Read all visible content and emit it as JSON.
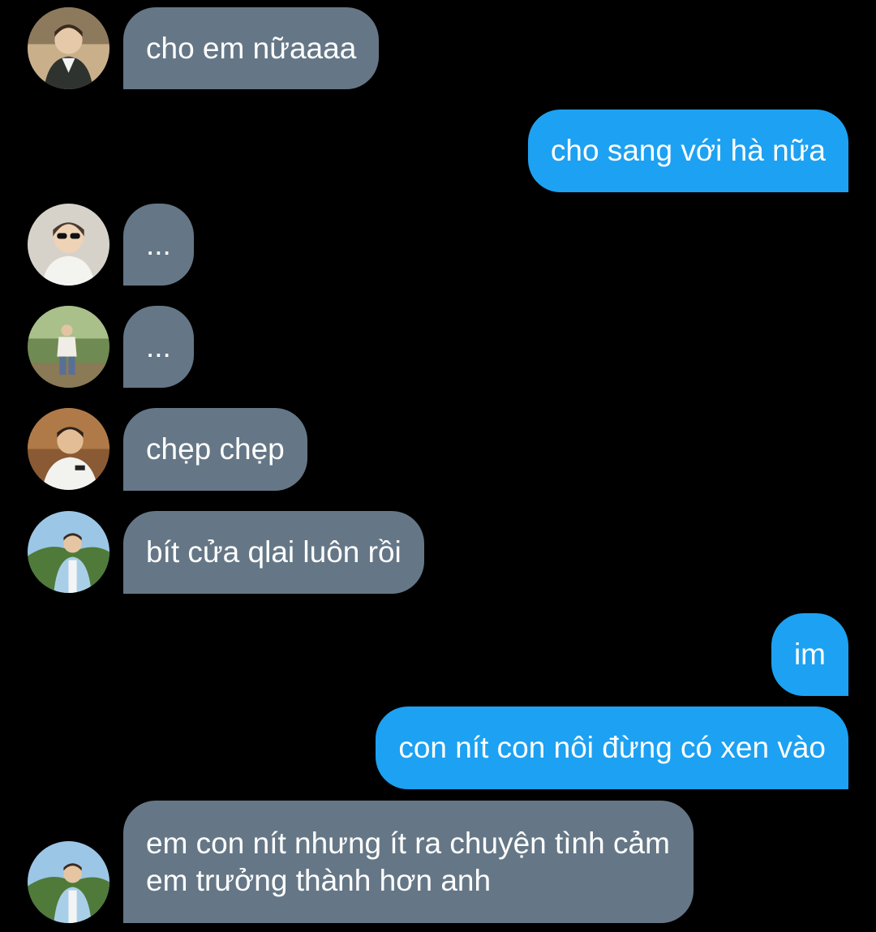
{
  "chat": {
    "messages": [
      {
        "sender": "other",
        "avatar": "avatar-1",
        "text": "cho em nữaaaa"
      },
      {
        "sender": "me",
        "text": "cho sang với hà nữa"
      },
      {
        "sender": "other",
        "avatar": "avatar-2",
        "text": "..."
      },
      {
        "sender": "other",
        "avatar": "avatar-3",
        "text": "..."
      },
      {
        "sender": "other",
        "avatar": "avatar-4",
        "text": "chẹp chẹp"
      },
      {
        "sender": "other",
        "avatar": "avatar-5",
        "text": "bít cửa qlai luôn rồi"
      },
      {
        "sender": "me",
        "text": "im"
      },
      {
        "sender": "me",
        "text": "con nít con nôi đừng có xen vào"
      },
      {
        "sender": "other",
        "avatar": "avatar-5",
        "text": "em con nít nhưng ít ra chuyện tình cảm em trưởng thành hơn anh"
      }
    ]
  },
  "colors": {
    "background": "#000000",
    "incoming_bubble": "#657786",
    "outgoing_bubble": "#1da1f2",
    "text": "#ffffff"
  }
}
